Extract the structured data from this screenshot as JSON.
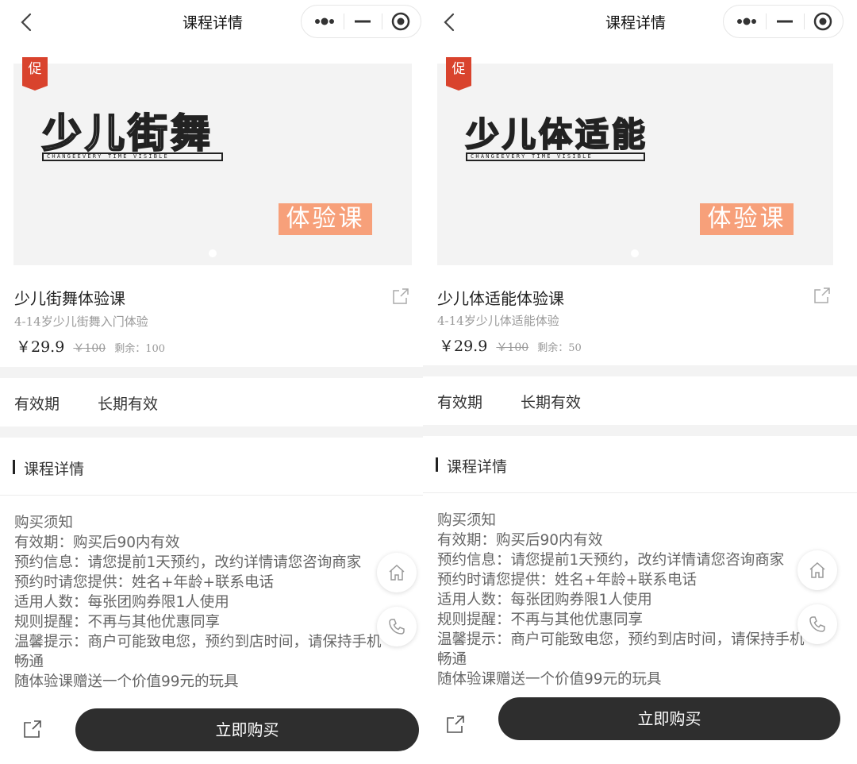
{
  "panels": [
    {
      "nav_title": "课程详情",
      "promo_tag": "促",
      "banner_title": "少儿街舞",
      "banner_strip": "CHANGEEVERY TIME VISIBLE",
      "banner_tag": "体验课",
      "course_name": "少儿街舞体验课",
      "course_sub": "4-14岁少儿街舞入门体验",
      "price_now": "￥29.9",
      "price_old": "￥100",
      "remain": "剩余：100",
      "validity_label": "有效期",
      "validity_value": "长期有效",
      "section_title": "课程详情",
      "notice_lines": [
        "购买须知",
        "有效期：购买后90内有效",
        "预约信息：请您提前1天预约，改约详情请您咨询商家",
        "预约时请您提供：姓名+年龄+联系电话",
        "适用人数：每张团购券限1人使用",
        "规则提醒：不再与其他优惠同享",
        "温馨提示：商户可能致电您，预约到店时间，请保持手机",
        "畅通",
        "随体验课赠送一个价值99元的玩具"
      ],
      "buy_label": "立即购买"
    },
    {
      "nav_title": "课程详情",
      "promo_tag": "促",
      "banner_title": "少儿体适能",
      "banner_strip": "CHANGEEVERY TIME VISIBLE",
      "banner_tag": "体验课",
      "course_name": "少儿体适能体验课",
      "course_sub": "4-14岁少儿体适能体验",
      "price_now": "￥29.9",
      "price_old": "￥100",
      "remain": "剩余：50",
      "validity_label": "有效期",
      "validity_value": "长期有效",
      "section_title": "课程详情",
      "notice_lines": [
        "购买须知",
        "有效期：购买后90内有效",
        "预约信息：请您提前1天预约，改约详情请您咨询商家",
        "预约时请您提供：姓名+年龄+联系电话",
        "适用人数：每张团购券限1人使用",
        "规则提醒：不再与其他优惠同享",
        "温馨提示：商户可能致电您，预约到店时间，请保持手机",
        "畅通",
        "随体验课赠送一个价值99元的玩具"
      ],
      "buy_label": "立即购买"
    }
  ],
  "icons": {
    "back": "chevron-left-icon",
    "more": "more-dots-icon",
    "minimize": "minus-icon",
    "close": "target-circle-icon",
    "share": "share-icon",
    "home": "home-icon",
    "phone": "phone-icon"
  },
  "colors": {
    "promo_red": "#d9432d",
    "tag_orange": "#f7a07a",
    "buy_button": "#2e2e2e"
  }
}
